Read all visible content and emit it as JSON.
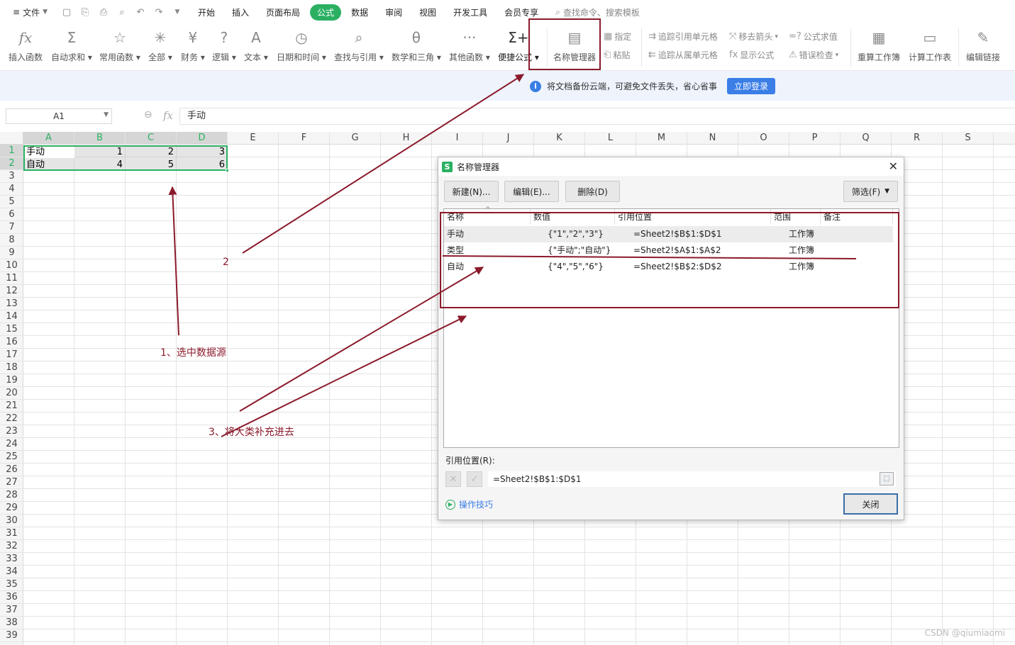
{
  "menu": {
    "file_label": "文件",
    "tabs": [
      "开始",
      "插入",
      "页面布局",
      "公式",
      "数据",
      "审阅",
      "视图",
      "开发工具",
      "会员专享"
    ],
    "active_tab": "公式",
    "search_placeholder": "查找命令、搜索模板"
  },
  "ribbon": {
    "insert_function": "插入函数",
    "autosum": "自动求和",
    "common_functions": "常用函数",
    "all": "全部",
    "finance": "财务",
    "logic": "逻辑",
    "text": "文本",
    "datetime": "日期和时间",
    "lookup": "查找与引用",
    "math": "数学和三角",
    "other_functions": "其他函数",
    "quick_formula": "便捷公式",
    "name_manager": "名称管理器",
    "specify": "指定",
    "paste": "粘贴",
    "trace_precedents": "追踪引用单元格",
    "trace_dependents": "追踪从属单元格",
    "remove_arrows": "移去箭头",
    "show_formulas": "显示公式",
    "evaluate_formula": "公式求值",
    "error_check": "错误检查",
    "recalc_workbook": "重算工作簿",
    "calc_sheet": "计算工作表",
    "edit_links": "编辑链接"
  },
  "notice": {
    "message": "将文档备份云端，可避免文件丢失，省心省事",
    "login_label": "立即登录"
  },
  "formula_bar": {
    "name_box": "A1",
    "content": "手动"
  },
  "sheet": {
    "columns": [
      "A",
      "B",
      "C",
      "D",
      "E",
      "F",
      "G",
      "H",
      "I",
      "J",
      "K",
      "L",
      "M",
      "N",
      "O",
      "P",
      "Q",
      "R",
      "S"
    ],
    "rows": [
      "1",
      "2",
      "3",
      "4",
      "5",
      "6",
      "7",
      "8",
      "9",
      "10",
      "11",
      "12",
      "13",
      "14",
      "15",
      "16",
      "17",
      "18",
      "19",
      "20",
      "21",
      "22",
      "23",
      "24",
      "25",
      "26",
      "27",
      "28",
      "29",
      "30",
      "31",
      "32",
      "33",
      "34",
      "35",
      "36",
      "37",
      "38",
      "39"
    ],
    "r1": {
      "a": "手动",
      "b": "1",
      "c": "2",
      "d": "3"
    },
    "r2": {
      "a": "自动",
      "b": "4",
      "c": "5",
      "d": "6"
    }
  },
  "annotations": {
    "step1": "1、选中数据源",
    "step2": "2",
    "step3": "3、将大类补充进去"
  },
  "dialog": {
    "title": "名称管理器",
    "new_button": "新建(N)...",
    "edit_button": "编辑(E)...",
    "delete_button": "删除(D)",
    "filter_button": "筛选(F)",
    "headers": {
      "name": "名称",
      "value": "数值",
      "refers_to": "引用位置",
      "scope": "范围",
      "comment": "备注"
    },
    "rows": [
      {
        "name": "手动",
        "value": "{\"1\",\"2\",\"3\"}",
        "refers_to": "=Sheet2!$B$1:$D$1",
        "scope": "工作簿"
      },
      {
        "name": "类型",
        "value": "{\"手动\";\"自动\"}",
        "refers_to": "=Sheet2!$A$1:$A$2",
        "scope": "工作簿"
      },
      {
        "name": "自动",
        "value": "{\"4\",\"5\",\"6\"}",
        "refers_to": "=Sheet2!$B$2:$D$2",
        "scope": "工作簿"
      }
    ],
    "refers_label": "引用位置(R):",
    "refers_value": "=Sheet2!$B$1:$D$1",
    "tips_label": "操作技巧",
    "close_button": "关闭"
  },
  "watermark": "CSDN @qiumiaomi",
  "colors": {
    "accent_green": "#2bb062",
    "annotation_red": "#8b1a2b",
    "link_blue": "#3a7ee6"
  }
}
